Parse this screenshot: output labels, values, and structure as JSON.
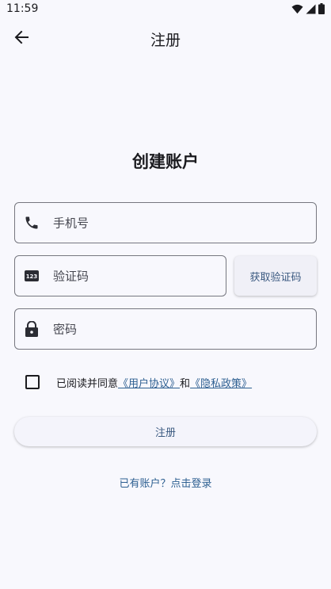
{
  "status_bar": {
    "time": "11:59",
    "icons": [
      "wifi-icon",
      "cellular-signal-icon",
      "battery-icon"
    ]
  },
  "app_bar": {
    "title": "注册",
    "back_icon": "arrow-back-icon"
  },
  "form": {
    "heading": "创建账户",
    "phone": {
      "label": "手机号",
      "icon": "phone-icon"
    },
    "code": {
      "label": "验证码",
      "icon": "dialpad-123-icon"
    },
    "get_code_button": "获取验证码",
    "password": {
      "label": "密码",
      "icon": "lock-icon"
    },
    "agreement": {
      "prefix": "已阅读并同意",
      "user_agreement": "《用户协议》",
      "conjunction": "和",
      "privacy_policy": "《隐私政策》"
    },
    "register_button": "注册",
    "login_link": "已有账户？点击登录"
  },
  "colors": {
    "background": "#f8f8fd",
    "accent": "#2d5f91",
    "button_text": "#3a5980",
    "outline": "#76777f"
  }
}
